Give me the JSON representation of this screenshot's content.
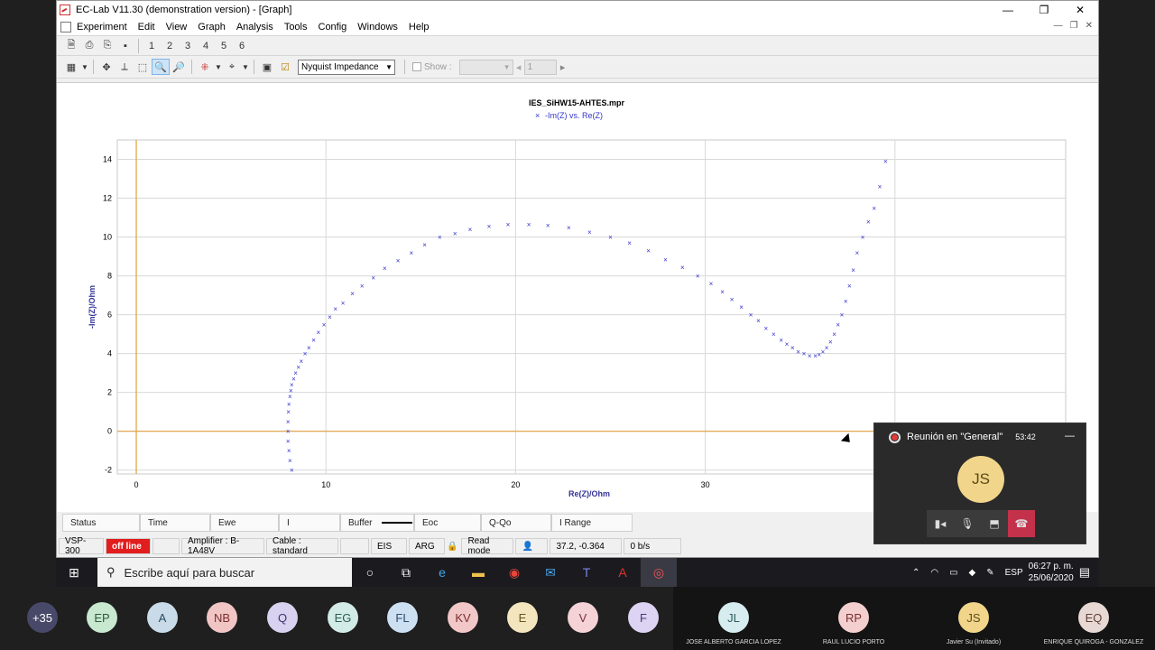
{
  "window": {
    "title": "EC-Lab V11.30 (demonstration version) - [Graph]"
  },
  "menu": [
    "Experiment",
    "Edit",
    "View",
    "Graph",
    "Analysis",
    "Tools",
    "Config",
    "Windows",
    "Help"
  ],
  "toolbar": {
    "pages": [
      "1",
      "2",
      "3",
      "4",
      "5",
      "6"
    ],
    "plot_select": "Nyquist Impedance",
    "show_label": "Show :",
    "show_value": "1"
  },
  "graph": {
    "file_title": "IES_SiHW15-AHTES.mpr",
    "legend": "-Im(Z) vs. Re(Z)",
    "xlabel": "Re(Z)/Ohm",
    "ylabel": "-Im(Z)/Ohm"
  },
  "chart_data": {
    "type": "scatter",
    "title": "IES_SiHW15-AHTES.mpr",
    "series": [
      {
        "name": "-Im(Z) vs. Re(Z)",
        "color": "#3333cc",
        "x": [
          8.2,
          8.1,
          8.05,
          8.0,
          8.0,
          8.0,
          8.02,
          8.05,
          8.1,
          8.15,
          8.2,
          8.3,
          8.4,
          8.55,
          8.7,
          8.9,
          9.1,
          9.35,
          9.6,
          9.9,
          10.2,
          10.5,
          10.9,
          11.4,
          11.9,
          12.5,
          13.1,
          13.8,
          14.5,
          15.2,
          16.0,
          16.8,
          17.6,
          18.6,
          19.6,
          20.7,
          21.7,
          22.8,
          23.9,
          25.0,
          26.0,
          27.0,
          27.9,
          28.8,
          29.6,
          30.3,
          30.9,
          31.4,
          31.9,
          32.4,
          32.8,
          33.2,
          33.6,
          34.0,
          34.3,
          34.6,
          34.9,
          35.2,
          35.5,
          35.8,
          36.0,
          36.2,
          36.4,
          36.6,
          36.8,
          37.0,
          37.2,
          37.4,
          37.6,
          37.8,
          38.0,
          38.3,
          38.6,
          38.9,
          39.2,
          39.5
        ],
        "y": [
          -2.0,
          -1.5,
          -1.0,
          -0.5,
          0.0,
          0.5,
          1.0,
          1.4,
          1.8,
          2.1,
          2.4,
          2.7,
          3.0,
          3.3,
          3.6,
          4.0,
          4.3,
          4.7,
          5.1,
          5.5,
          5.9,
          6.3,
          6.6,
          7.1,
          7.5,
          7.9,
          8.4,
          8.8,
          9.2,
          9.6,
          10.0,
          10.2,
          10.4,
          10.55,
          10.65,
          10.65,
          10.6,
          10.5,
          10.25,
          10.0,
          9.7,
          9.3,
          8.85,
          8.45,
          8.0,
          7.6,
          7.2,
          6.8,
          6.4,
          6.0,
          5.7,
          5.3,
          5.0,
          4.7,
          4.5,
          4.3,
          4.1,
          4.0,
          3.9,
          3.9,
          3.95,
          4.1,
          4.3,
          4.6,
          5.0,
          5.5,
          6.0,
          6.7,
          7.5,
          8.3,
          9.2,
          10.0,
          10.8,
          11.5,
          12.6,
          13.9
        ]
      }
    ],
    "xlim": [
      -1,
      49
    ],
    "ylim": [
      -2.2,
      15
    ],
    "xticks": [
      0,
      10,
      20,
      30
    ],
    "yticks": [
      -2,
      0,
      2,
      4,
      6,
      8,
      10,
      12,
      14
    ],
    "xlabel": "Re(Z)/Ohm",
    "ylabel": "-Im(Z)/Ohm",
    "grid": true
  },
  "status": [
    "Status",
    "Time",
    "Ewe",
    "I",
    "Buffer",
    "Eoc",
    "Q-Qo",
    "I Range"
  ],
  "info": {
    "device": "VSP-300",
    "state": "off line",
    "amplifier": "Amplifier : B-1A48V",
    "cable": "Cable : standard",
    "eis": "EIS",
    "arg": "ARG",
    "mode": "Read mode",
    "coords": "37.2, -0.364",
    "rate": "0 b/s"
  },
  "taskbar": {
    "search_placeholder": "Escribe aquí para buscar",
    "lang": "ESP",
    "time": "06:27 p. m.",
    "date": "25/06/2020"
  },
  "meeting": {
    "title": "Reunión en \"General\"",
    "duration": "53:42",
    "initials": "JS"
  },
  "participants": [
    {
      "initials": "+35",
      "color": "#484869",
      "text": "#ffffff"
    },
    {
      "initials": "EP",
      "color": "#c9e8d0",
      "text": "#2f5a3a"
    },
    {
      "initials": "A",
      "color": "#c9dbe8",
      "text": "#2a4a63"
    },
    {
      "initials": "NB",
      "color": "#f2c5c5",
      "text": "#7a2e2e"
    },
    {
      "initials": "Q",
      "color": "#d8d2f0",
      "text": "#3e3470"
    },
    {
      "initials": "EG",
      "color": "#d2ebe6",
      "text": "#2f5c55"
    },
    {
      "initials": "FL",
      "color": "#cde0f2",
      "text": "#2c4a6c"
    },
    {
      "initials": "KV",
      "color": "#f2c7c7",
      "text": "#7b2d2d"
    },
    {
      "initials": "E",
      "color": "#f3e6be",
      "text": "#6a5520"
    },
    {
      "initials": "V",
      "color": "#f4d2d6",
      "text": "#7a3040"
    },
    {
      "initials": "F",
      "color": "#ddd3f2",
      "text": "#463a75"
    }
  ],
  "named_participants": [
    {
      "initials": "JL",
      "name": "JOSE ALBERTO GARCIA LOPEZ",
      "color": "#d6ecee",
      "text": "#2f5a5e"
    },
    {
      "initials": "RP",
      "name": "RAUL LUCIO PORTO",
      "color": "#f4cfcf",
      "text": "#7a2e2e"
    },
    {
      "initials": "JS",
      "name": "Javier Su (Invitado)",
      "color": "#f0d58a",
      "text": "#5c4a1a"
    },
    {
      "initials": "EQ",
      "name": "ENRIQUE QUIROGA - GONZALEZ",
      "color": "#e8d8d4",
      "text": "#5e3f38"
    }
  ]
}
